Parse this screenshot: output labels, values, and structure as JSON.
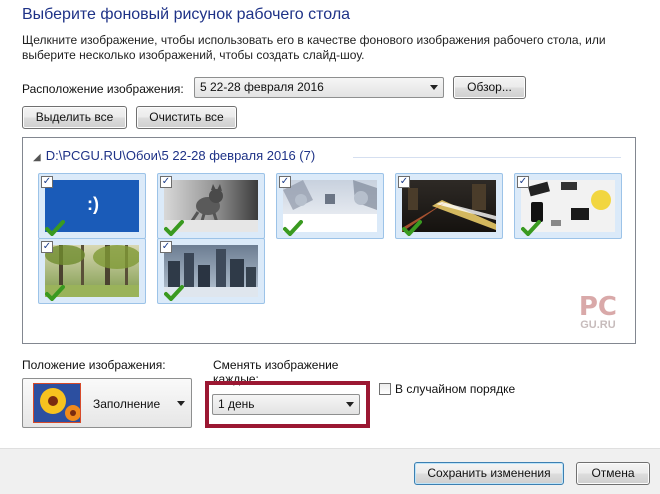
{
  "header": {
    "title": "Выберите фоновый рисунок рабочего стола",
    "description": "Щелкните изображение, чтобы использовать его в качестве фонового изображения рабочего стола, или выберите несколько изображений, чтобы создать слайд-шоу."
  },
  "location": {
    "label": "Расположение изображения:",
    "value": "5 22-28 февраля 2016",
    "browse_label": "Обзор..."
  },
  "selection": {
    "select_all": "Выделить все",
    "clear_all": "Очистить все"
  },
  "gallery": {
    "folder_path": "D:\\PCGU.RU\\Обои\\5 22-28 февраля 2016 (7)",
    "checked_mark": "✓",
    "watermark_top": "PC",
    "watermark_bottom": "GU.RU",
    "thumbnails": [
      {
        "icon": "blue-sad-face-wallpaper",
        "checked": true
      },
      {
        "icon": "cat-wallpaper",
        "checked": true
      },
      {
        "icon": "snowy-street-wallpaper",
        "checked": true
      },
      {
        "icon": "night-traffic-wallpaper",
        "checked": true
      },
      {
        "icon": "desk-workspace-wallpaper",
        "checked": true
      },
      {
        "icon": "forest-wallpaper",
        "checked": true
      },
      {
        "icon": "city-skyline-wallpaper",
        "checked": true
      }
    ],
    "blue_face_text": ":)"
  },
  "position": {
    "label": "Положение изображения:",
    "value": "Заполнение"
  },
  "interval": {
    "label": "Сменять изображение каждые:",
    "value": "1 день"
  },
  "shuffle": {
    "label": "В случайном порядке",
    "checked": false
  },
  "footer": {
    "save_label": "Сохранить изменения",
    "cancel_label": "Отмена"
  },
  "colors": {
    "title": "#1e3287",
    "highlight_frame": "#9b1732",
    "thumb_selected_bg": "#dbeaf9",
    "check_green": "#3a9a20"
  }
}
